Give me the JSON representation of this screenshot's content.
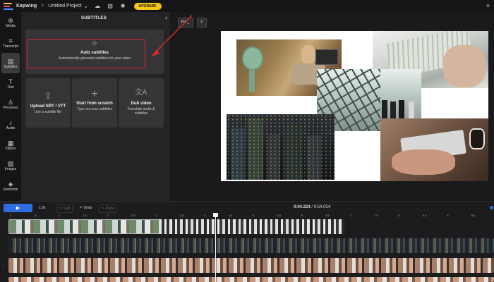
{
  "topbar": {
    "brand": "Kapwing",
    "separator": ">",
    "project": "Untitled Project",
    "project_chevron": "⌄",
    "upgrade": "UPGRADE",
    "icons": [
      "cloud-icon",
      "image-icon",
      "lightbulb-icon"
    ]
  },
  "nav": [
    {
      "label": "Media",
      "icon": "plus-icon",
      "glyph": "⊕"
    },
    {
      "label": "Transcript",
      "icon": "transcript-icon",
      "glyph": "≡"
    },
    {
      "label": "Subtitles",
      "icon": "subtitles-icon",
      "glyph": "▤"
    },
    {
      "label": "Text",
      "icon": "text-icon",
      "glyph": "T"
    },
    {
      "label": "Personas",
      "icon": "person-icon",
      "glyph": "♙"
    },
    {
      "label": "Audio",
      "icon": "music-icon",
      "glyph": "♪"
    },
    {
      "label": "Videos",
      "icon": "film-icon",
      "glyph": "▦"
    },
    {
      "label": "Images",
      "icon": "image-icon",
      "glyph": "▨"
    },
    {
      "label": "Elements",
      "icon": "shapes-icon",
      "glyph": "◈"
    }
  ],
  "panel": {
    "title": "SUBTITLES",
    "collapse": "‹",
    "auto": {
      "title": "Auto subtitles",
      "desc": "Automatically generate subtitles for your video",
      "glyph": "✧"
    },
    "upload": {
      "title": "Upload SRT / VTT",
      "desc": "Use a subtitle file",
      "glyph": "⇪"
    },
    "scratch": {
      "title": "Start from scratch",
      "desc": "Type out your subtitles",
      "glyph": "+"
    },
    "dub": {
      "title": "Dub video",
      "desc": "Translate audio & subtitles",
      "glyph": "文A"
    }
  },
  "stage": {
    "fit": "Fit",
    "fit_chevron": "⌄"
  },
  "timeline": {
    "speed": "1.0x",
    "split": "✂ Split",
    "undo": "↶ Undo",
    "redo": "↷ Redo",
    "current": "0:04.224",
    "total": "0:54.054",
    "ticks": [
      "0",
      ".5",
      "1",
      "1.5",
      "2",
      "2.5",
      "3",
      "3.5",
      "4",
      "4.5",
      "5",
      "5.5",
      "6",
      "6.5",
      "7",
      "7.5",
      "8",
      "8.5",
      "9",
      "9.5"
    ]
  },
  "colors": {
    "accent": "#2f6ce0",
    "upgrade": "#f5c518",
    "highlight": "#e0262e"
  }
}
